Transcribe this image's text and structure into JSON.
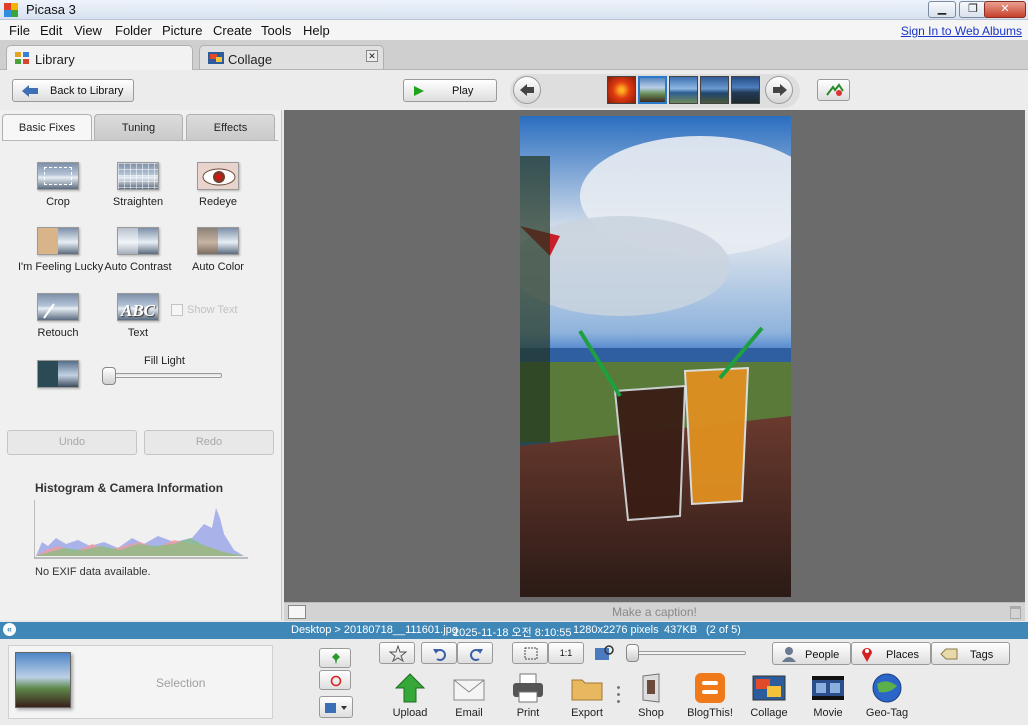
{
  "window": {
    "title": "Picasa 3",
    "min_glyph": "▁",
    "max_glyph": "❐",
    "close_glyph": "✕"
  },
  "menubar": {
    "items": [
      "File",
      "Edit",
      "View",
      "Folder",
      "Picture",
      "Create",
      "Tools",
      "Help"
    ],
    "signin": "Sign In to Web Albums"
  },
  "tabs": {
    "library": "Library",
    "collage": "Collage",
    "close_glyph": "✕"
  },
  "toolbar": {
    "back_label": "Back to Library",
    "play_label": "Play"
  },
  "edit_tabs": [
    "Basic Fixes",
    "Tuning",
    "Effects"
  ],
  "tools": {
    "crop": "Crop",
    "straighten": "Straighten",
    "redeye": "Redeye",
    "lucky": "I'm Feeling Lucky",
    "auto_contrast": "Auto Contrast",
    "auto_color": "Auto Color",
    "retouch": "Retouch",
    "text": "Text",
    "show_text": "Show Text",
    "text_glyph": "ABC",
    "fill_light": "Fill Light"
  },
  "undo_label": "Undo",
  "redo_label": "Redo",
  "histogram": {
    "title": "Histogram & Camera Information",
    "exif": "No EXIF data available."
  },
  "caption": {
    "placeholder": "Make a caption!"
  },
  "status": {
    "path": "Desktop > 20180718__111601.jpg",
    "date": "2025-11-18 오전 8:10:55",
    "dims": "1280x2276 pixels",
    "size": "437KB",
    "position": "(2 of 5)"
  },
  "tray": {
    "selection_label": "Selection"
  },
  "actions": [
    "Upload",
    "Email",
    "Print",
    "Export",
    "Shop",
    "BlogThis!",
    "Collage",
    "Movie",
    "Geo-Tag"
  ],
  "tag_buttons": {
    "people": "People",
    "places": "Places",
    "tags": "Tags"
  },
  "zoom": {
    "one_to_one": "1:1"
  }
}
